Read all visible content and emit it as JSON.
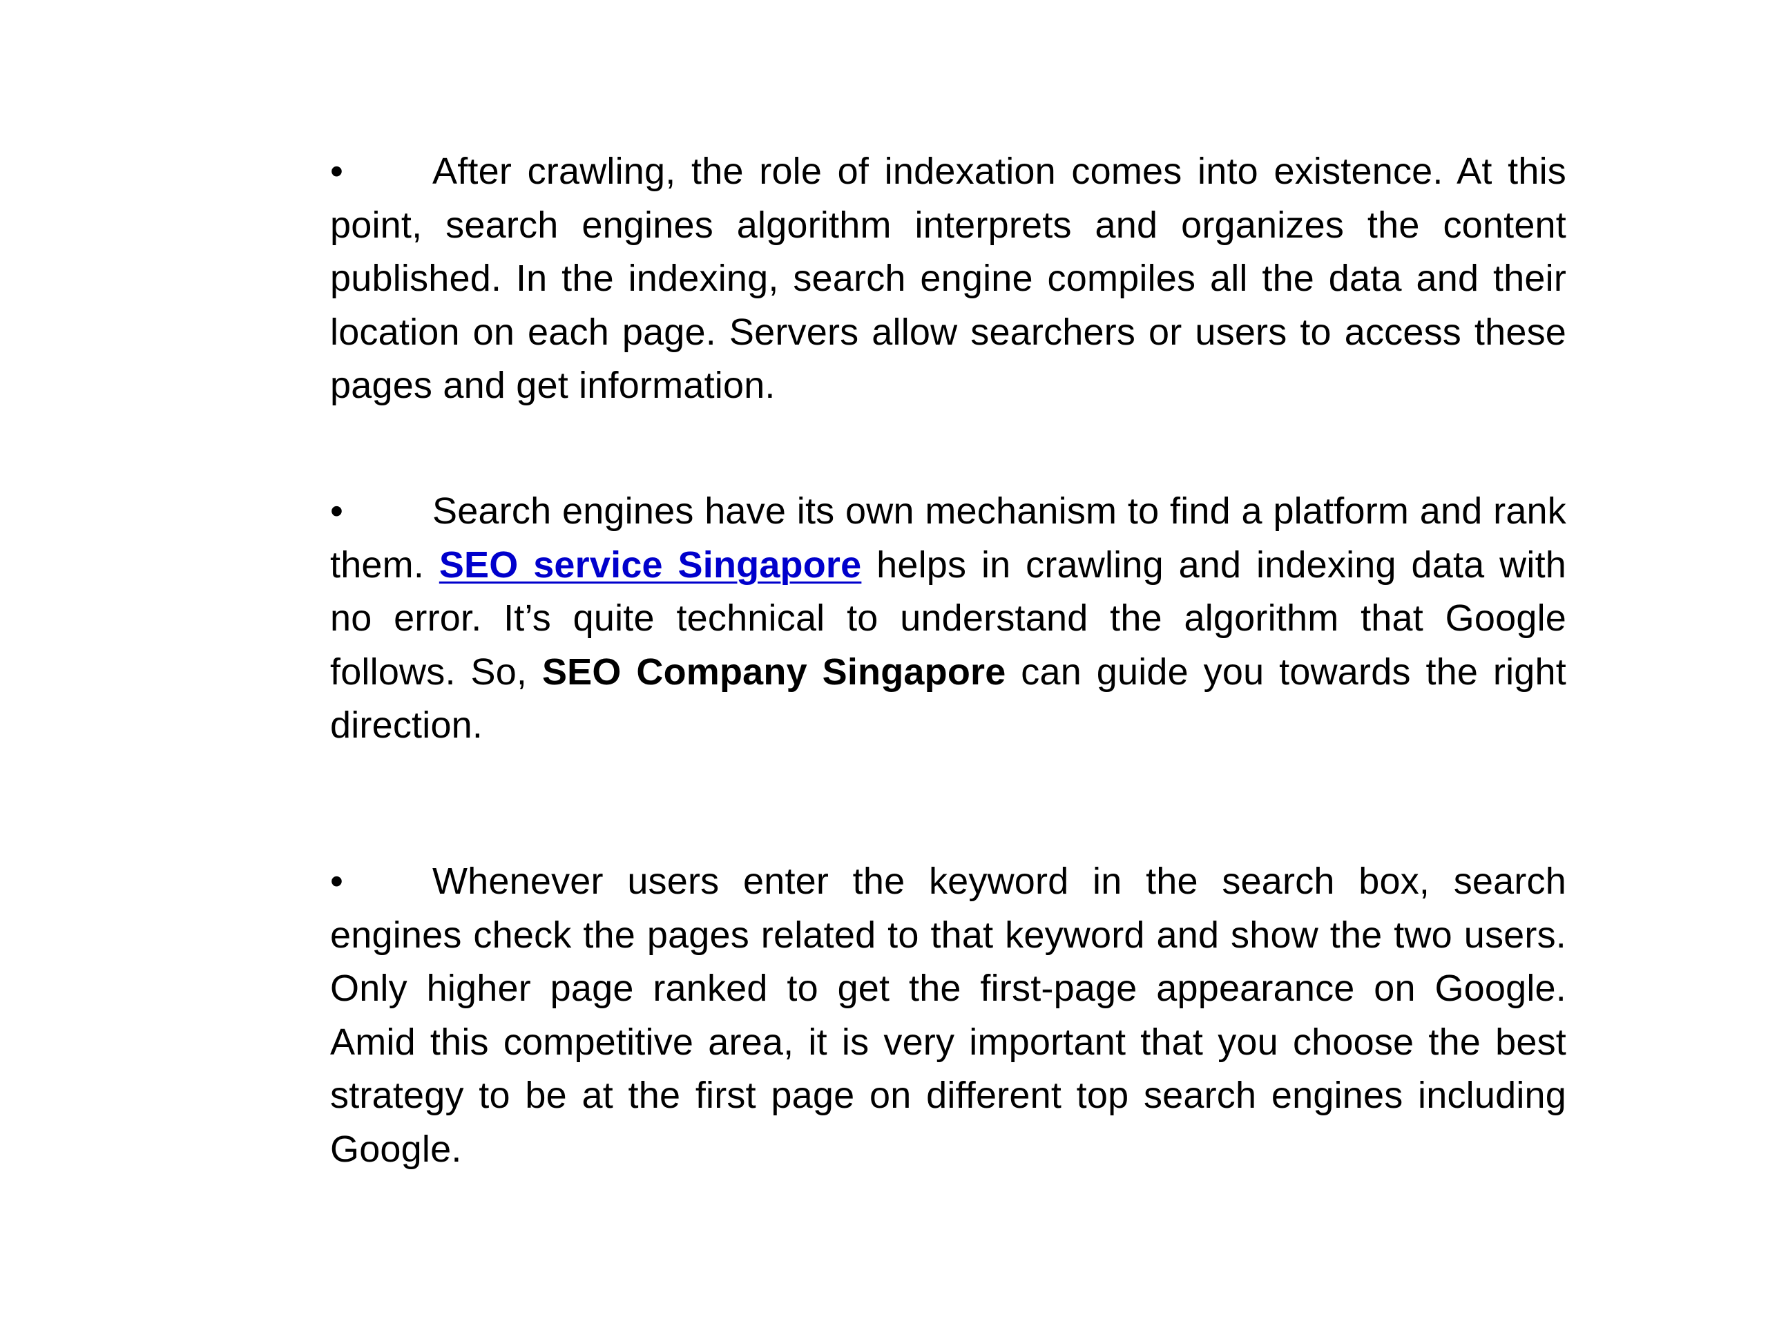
{
  "document": {
    "bullet_glyph": "•",
    "paragraphs": [
      {
        "text": "After crawling, the role of indexation comes into existence. At this point, search engines algorithm interprets and organizes the content published. In the indexing, search engine compiles all the data and their location on each page. Servers allow searchers or users to access these pages and get information."
      },
      {
        "before_link": "Search engines have its own mechanism to find a platform and rank them. ",
        "link_text": "SEO service Singapore",
        "middle": " helps in crawling and indexing data with no error. It’s quite technical to understand the algorithm that Google follows. So, ",
        "bold_text": "SEO Company Singapore",
        "after_bold": " can guide you towards the right direction."
      },
      {
        "text": "Whenever users enter the keyword in the search box, search engines check the pages related to that keyword and show the two users. Only higher page ranked to get the first-page appearance on Google. Amid this competitive area, it is very important that you choose the best strategy to be at the first page on different top search engines including Google."
      }
    ],
    "colors": {
      "text": "#000000",
      "link": "#0000cc",
      "background": "#ffffff"
    }
  }
}
